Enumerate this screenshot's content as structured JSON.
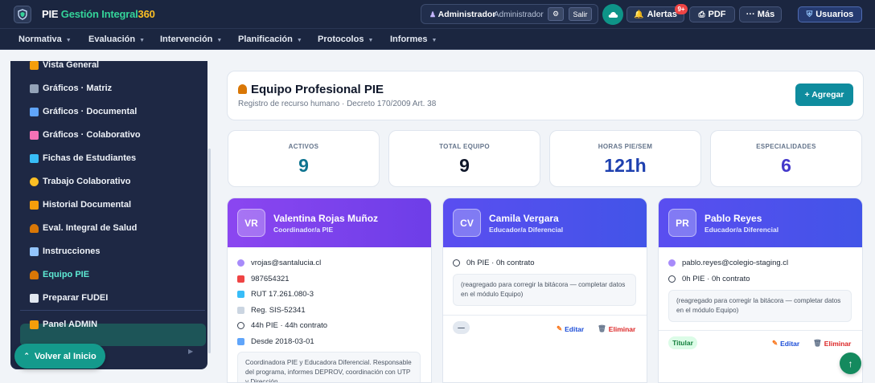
{
  "app": {
    "brand_pie": "PIE",
    "brand_main": "Gestión Integral",
    "brand_num": "360"
  },
  "user": {
    "name": "Administrador",
    "role": "Administrador",
    "logout_label": "Salir"
  },
  "toolbar": {
    "alerts_label": "Alertas",
    "alerts_badge": "9+",
    "pdf_label": "PDF",
    "more_label": "··· Más",
    "users_label": "Usuarios"
  },
  "nav": {
    "items": [
      {
        "label": "Normativa"
      },
      {
        "label": "Evaluación"
      },
      {
        "label": "Intervención"
      },
      {
        "label": "Planificación"
      },
      {
        "label": "Protocolos"
      },
      {
        "label": "Informes"
      }
    ]
  },
  "sidebar": {
    "items": [
      {
        "label": "Vista General"
      },
      {
        "label": "Gráficos · Matriz"
      },
      {
        "label": "Gráficos · Documental"
      },
      {
        "label": "Gráficos · Colaborativo"
      },
      {
        "label": "Fichas de Estudiantes"
      },
      {
        "label": "Trabajo Colaborativo"
      },
      {
        "label": "Historial Documental"
      },
      {
        "label": "Eval. Integral de Salud"
      },
      {
        "label": "Instrucciones"
      },
      {
        "label": "Equipo PIE",
        "active": true
      },
      {
        "label": "Preparar FUDEI"
      },
      {
        "label": "Panel ADMIN"
      }
    ],
    "back_label": "Volver al Inicio"
  },
  "page": {
    "title": "Equipo Profesional PIE",
    "subtitle": "Registro de recurso humano · Decreto 170/2009 Art. 38",
    "add_label": "+ Agregar"
  },
  "stats": [
    {
      "label": "ACTIVOS",
      "value": "9",
      "color": "#0e7490"
    },
    {
      "label": "TOTAL EQUIPO",
      "value": "9",
      "color": "#0f172a"
    },
    {
      "label": "HORAS PIE/SEM",
      "value": "121h",
      "color": "#1e40af"
    },
    {
      "label": "ESPECIALIDADES",
      "value": "6",
      "color": "#4338ca"
    }
  ],
  "staff": [
    {
      "initials": "VR",
      "name": "Valentina Rojas Muñoz",
      "role": "Coordinador/a PIE",
      "email": "vrojas@santalucia.cl",
      "phone": "987654321",
      "rut": "RUT 17.261.080-3",
      "reg": "Reg. SIS-52341",
      "hours": "44h PIE · 44h contrato",
      "since": "Desde 2018-03-01",
      "note": "Coordinadora PIE y Educadora Diferencial. Responsable del programa, informes DEPROV, coordinación con UTP y Dirección."
    },
    {
      "initials": "CV",
      "name": "Camila Vergara",
      "role": "Educador/a Diferencial",
      "hours": "0h PIE · 0h contrato",
      "note": "(reagregado para corregir la bitácora — completar datos en el módulo Equipo)",
      "chip": "—",
      "edit_label": "Editar",
      "delete_label": "Eliminar"
    },
    {
      "initials": "PR",
      "name": "Pablo Reyes",
      "role": "Educador/a Diferencial",
      "email": "pablo.reyes@colegio-staging.cl",
      "hours": "0h PIE · 0h contrato",
      "note": "(reagregado para corregir la bitácora — completar datos en el módulo Equipo)",
      "chip": "Titular",
      "edit_label": "Editar",
      "delete_label": "Eliminar"
    }
  ],
  "colors": {
    "card1_gradient": [
      "#8b46f0",
      "#6d3ee8"
    ],
    "card2_gradient": [
      "#5a4ef0",
      "#4254e8"
    ],
    "card3_gradient": [
      "#5a4ef0",
      "#4254e8"
    ],
    "accent_teal": "#0f8c9e"
  }
}
